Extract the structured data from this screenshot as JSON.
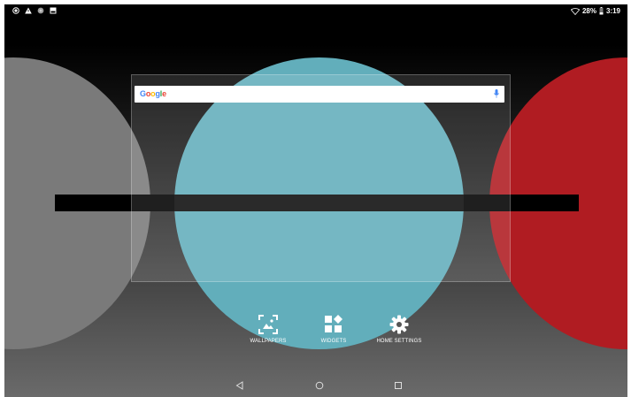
{
  "status_bar": {
    "left_icons": [
      "record-icon",
      "alert-icon",
      "sync-icon",
      "image-icon"
    ],
    "battery_percent": "28%",
    "time": "3:19"
  },
  "search_bar": {
    "logo_text": "Google",
    "logo_colors": [
      "#4285F4",
      "#EA4335",
      "#FBBC05",
      "#4285F4",
      "#34A853",
      "#EA4335"
    ],
    "mic_color": "#4285F4"
  },
  "actions": [
    {
      "label": "WALLPAPERS",
      "icon": "wallpaper-icon"
    },
    {
      "label": "WIDGETS",
      "icon": "widgets-icon"
    },
    {
      "label": "HOME SETTINGS",
      "icon": "gear-icon"
    }
  ],
  "nav_bar": {
    "buttons": [
      "back-icon",
      "home-icon",
      "recents-icon"
    ]
  },
  "colors": {
    "teal": "#62aebb",
    "red": "#b01c22",
    "gray": "#7a7a7a"
  }
}
